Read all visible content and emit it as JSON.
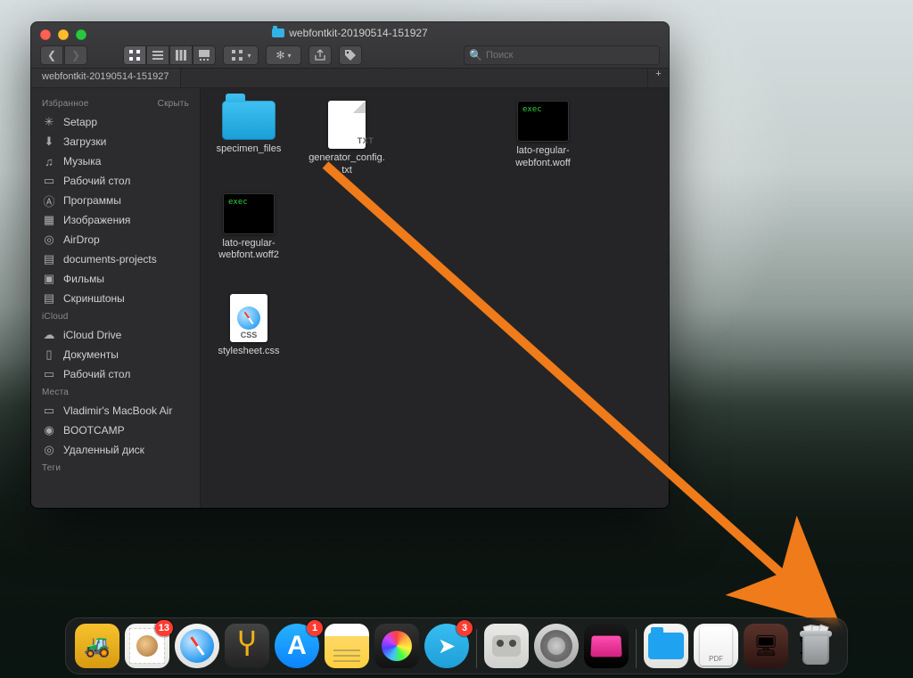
{
  "window": {
    "title": "webfontkit-20190514-151927",
    "search_placeholder": "Поиск",
    "tab_label": "webfontkit-20190514-151927"
  },
  "sidebar": {
    "favorites": {
      "header": "Избранное",
      "hide": "Скрыть"
    },
    "icloud_header": "iCloud",
    "locations_header": "Места",
    "tags_header": "Теги",
    "items_fav": [
      {
        "label": "Setapp"
      },
      {
        "label": "Загрузки"
      },
      {
        "label": "Музыка"
      },
      {
        "label": "Рабочий стол"
      },
      {
        "label": "Программы"
      },
      {
        "label": "Изображения"
      },
      {
        "label": "AirDrop"
      },
      {
        "label": "documents-projects"
      },
      {
        "label": "Фильмы"
      },
      {
        "label": "Скриншtоны"
      }
    ],
    "items_icloud": [
      {
        "label": "iCloud Drive"
      },
      {
        "label": "Документы"
      },
      {
        "label": "Рабочий стол"
      }
    ],
    "items_loc": [
      {
        "label": "Vladimir's MacBook Air"
      },
      {
        "label": "BOOTCAMP"
      },
      {
        "label": "Удаленный диск"
      }
    ]
  },
  "files": [
    {
      "name": "specimen_files",
      "type": "folder"
    },
    {
      "name": "generator_config.txt",
      "type": "txt",
      "badge": "TXT"
    },
    {
      "name": "lato-regular-webfont.woff",
      "type": "exec",
      "badge": "exec"
    },
    {
      "name": "lato-regular-webfont.woff2",
      "type": "exec",
      "badge": "exec"
    },
    {
      "name": "stylesheet.css",
      "type": "css",
      "badge": "CSS"
    }
  ],
  "dock": {
    "apps": [
      {
        "name": "forklift"
      },
      {
        "name": "mail",
        "badge": "13"
      },
      {
        "name": "safari"
      },
      {
        "name": "sublime-text"
      },
      {
        "name": "app-store",
        "badge": "1"
      },
      {
        "name": "notes"
      },
      {
        "name": "davinci-resolve"
      },
      {
        "name": "telegram",
        "badge": "3"
      }
    ],
    "apps2": [
      {
        "name": "tweetbot"
      },
      {
        "name": "system-settings"
      },
      {
        "name": "cleanmymac"
      }
    ],
    "apps3": [
      {
        "name": "dropbox-folder"
      },
      {
        "name": "pdf-document"
      },
      {
        "name": "parallels"
      },
      {
        "name": "trash"
      }
    ]
  }
}
